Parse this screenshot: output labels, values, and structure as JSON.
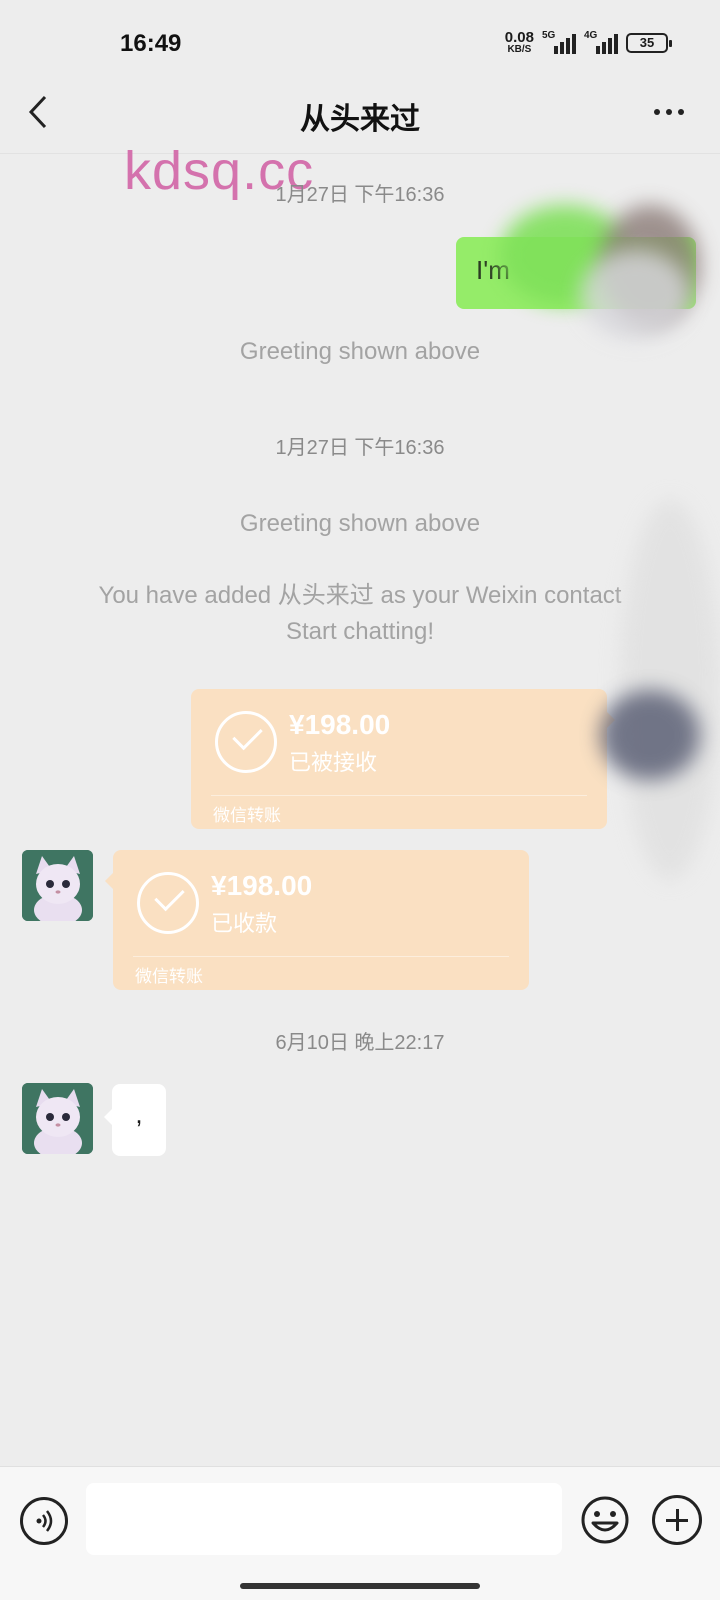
{
  "status_bar": {
    "time": "16:49",
    "net_speed_value": "0.08",
    "net_speed_unit": "KB/S",
    "signal_1_label": "5G",
    "signal_2_label": "4G",
    "battery": "35"
  },
  "nav": {
    "title": "从头来过",
    "back_icon": "chevron-left-icon",
    "more_icon": "more-dots-icon"
  },
  "watermark": "kdsq.cc",
  "messages": {
    "ts1": "1月27日 下午16:36",
    "outgoing_text": "I'm",
    "greeting_1": "Greeting shown above",
    "ts2": "1月27日 下午16:36",
    "greeting_2": "Greeting shown above",
    "added_line1": "You have added 从头来过 as your Weixin contact",
    "added_line2": "Start chatting!",
    "transfer_sent": {
      "amount": "¥198.00",
      "status": "已被接收",
      "label": "微信转账"
    },
    "transfer_received": {
      "amount": "¥198.00",
      "status": "已收款",
      "label": "微信转账"
    },
    "ts3": "6月10日 晚上22:17",
    "incoming_text": ","
  },
  "input_bar": {
    "voice_icon": "voice-icon",
    "emoji_icon": "emoji-icon",
    "plus_icon": "plus-icon",
    "placeholder": ""
  },
  "colors": {
    "background": "#ededed",
    "outgoing_bubble": "#95ec69",
    "transfer_card": "#fae0c2",
    "watermark": "#d472ad"
  }
}
